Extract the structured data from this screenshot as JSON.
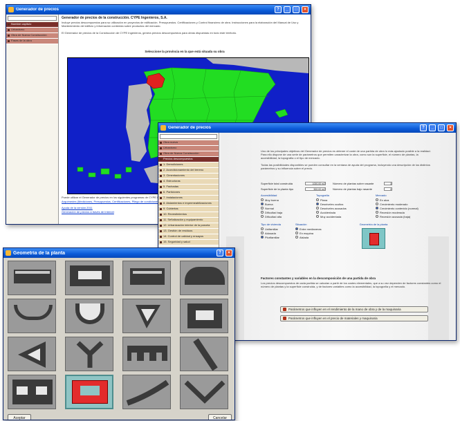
{
  "window1": {
    "title": "Generador de precios",
    "sidebar": {
      "items": [
        "Nombre capítulo",
        "Urbanismo",
        "Obra de Nueva Construcción",
        "Fases de la obra"
      ]
    },
    "header_title": "Generador de precios de la construcción. CYPE Ingenieros, S.A.",
    "intro": "Incluye precios descompuestos para su utilización en proyectos de edificación. Presupuestos. Certificaciones y Control financiero de obra. Instrucciones para la elaboración del Manual de Uso y Mantenimiento del edificio y información contenida sobre productos del mercado.",
    "intro2": "El Generador de precios de la Construcción de CYPE Ingenieros, genera precios descompuestos para obras dispuestas en todo este territorio.",
    "map_title": "Seleccione la provincia en la que está situada su obra",
    "footer_text": "Puede utilizar el Generador de precios en los siguientes programas de CYPE Ingenieros:",
    "links": [
      "Arquímedes (Mediciones, Presupuestos, Certificaciones, Pliego de condiciones)",
      "Ayuda de la versión 2011",
      "Generación de precios a través de Internet"
    ]
  },
  "window2": {
    "title": "Generador de precios",
    "sidebar": {
      "items": [
        "Obra nueva",
        "Urbanismo",
        "Obra de Nueva Construcción",
        "Precios descompuestos",
        "1. Demoliciones",
        "2. Acondicionamiento del terreno",
        "3. Cimentaciones",
        "4. Estructuras",
        "5. Fachadas",
        "6. Particiones",
        "7. Instalaciones",
        "8. Aislamientos e impermeabilizaciones",
        "9. Cubiertas",
        "10. Revestimientos",
        "11. Señalización y equipamiento",
        "12. Urbanización interior de la parcela",
        "13. Gestión de residuos",
        "14. Control de calidad y ensayos",
        "15. Seguridad y salud"
      ]
    },
    "intro": "Uno de los principales objetivos del Generador de precios es obtener el coste de una partida de obra lo más ajustado posible a la realidad. Para ello dispone de una serie de parámetros que permiten caracterizar la obra, como son la superficie, el número de plantas, la accesibilidad, la topografía o el tipo de mercado.",
    "intro2": "Todas las posibilidades disponibles se pueden consultar en la ventana de ayuda del programa, incluyendo una descripción de los distintos parámetros y su influencia sobre el precio.",
    "fields": [
      {
        "label": "Superficie total construida",
        "value": "1000.00 m2",
        "label2": "Número de plantas sobre rasante",
        "value2": "3"
      },
      {
        "label": "Superficie de la planta tipo",
        "value": "500.00 m2",
        "label2": "Número de plantas bajo rasante",
        "value2": "0"
      }
    ],
    "groups": [
      {
        "title": "Accesibilidad",
        "options": [
          "Muy buena",
          "Buena",
          "Normal",
          "Dificultad baja",
          "Dificultad alta"
        ],
        "selected": 1
      },
      {
        "title": "Topografía",
        "options": [
          "Plana",
          "Desniveles ocultos",
          "Desniveles acusados",
          "Accidentada",
          "Muy accidentada"
        ],
        "selected": 1
      },
      {
        "title": "Mercado",
        "options": [
          "En alza",
          "Crecimiento moderado",
          "Crecimiento contenido (normal)",
          "Recesión moderada",
          "Recesión acusada (baja)"
        ],
        "selected": 2
      }
    ],
    "groups2": [
      {
        "title": "Tipo de vivienda",
        "options": [
          "Unifamiliar",
          "Adosada",
          "Plurifamiliar"
        ],
        "selected": 2
      },
      {
        "title": "Situación",
        "options": [
          "Entre medianeras",
          "En esquina",
          "Aislada"
        ],
        "selected": 0
      }
    ],
    "geom_label": "Geometría de la planta",
    "section_title": "Factores constantes y variables en la descomposición de una partida de obra",
    "section_text": "Los precios descompuestos de cada partida se calculan a partir de los costes elementales, que a su vez dependen de factores constantes como el número de plantas y la superficie construida, y de factores variables como la accesibilidad, la topografía y el mercado.",
    "btn1": "Parámetros que influyen en el rendimiento de la mano de obra y de la maquinaria",
    "btn2": "Parámetros que influyen en el precio de materiales y maquinaria"
  },
  "window3": {
    "title": "Geometría de la planta",
    "accept": "Aceptar",
    "cancel": "Cancelar",
    "selected_index": 13
  }
}
